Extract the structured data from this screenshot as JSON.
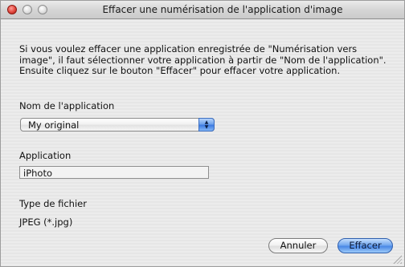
{
  "window": {
    "title": "Effacer une numérisation de l'application d'image"
  },
  "dialog": {
    "description": "Si vous voulez effacer une application enregistrée de \"Numérisation vers image\", il faut sélectionner votre application à partir de \"Nom de l'application\". Ensuite cliquez sur le bouton \"Effacer\" pour effacer votre application.",
    "app_name_label": "Nom de l'application",
    "app_name_selected": "My original",
    "application_label": "Application",
    "application_value": "iPhoto",
    "file_type_label": "Type de fichier",
    "file_type_value": "JPEG (*.jpg)",
    "cancel_label": "Annuler",
    "delete_label": "Effacer"
  },
  "colors": {
    "default_button": "#4a88e6",
    "close_button": "#e0463d"
  }
}
